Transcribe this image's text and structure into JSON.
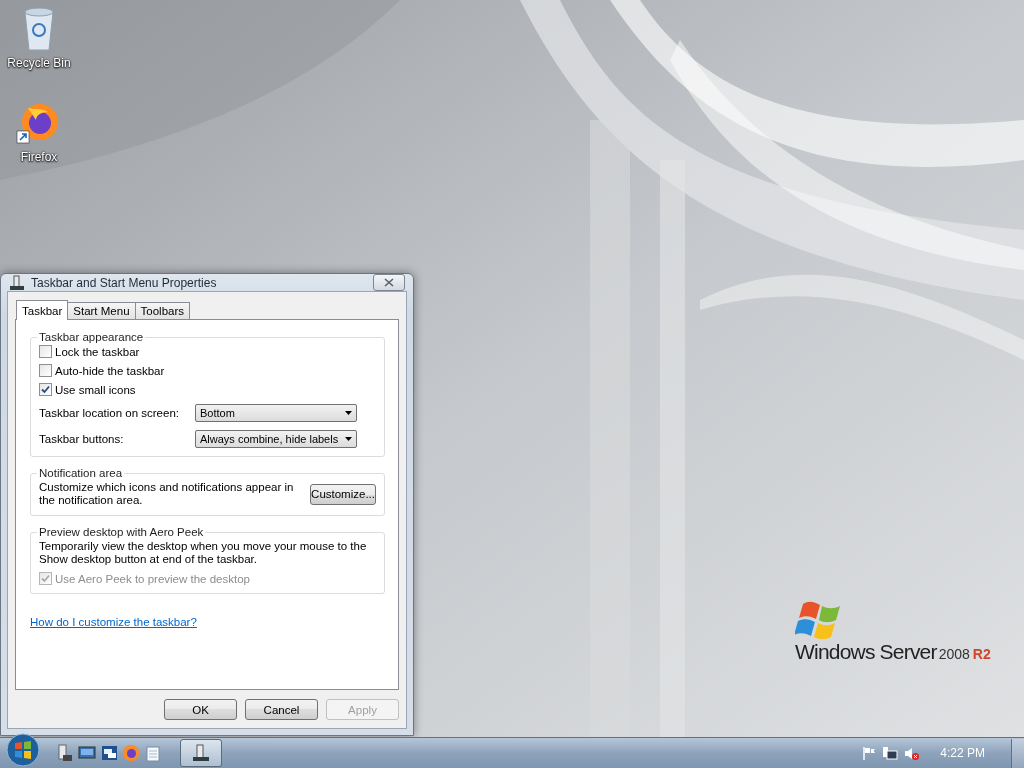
{
  "desktop_icons": [
    {
      "kind": "recycle-bin",
      "label": "Recycle Bin"
    },
    {
      "kind": "browser",
      "label": "Firefox"
    }
  ],
  "dialog": {
    "title": "Taskbar and Start Menu Properties",
    "tabs": [
      {
        "label": "Taskbar",
        "selected": true
      },
      {
        "label": "Start Menu",
        "selected": false
      },
      {
        "label": "Toolbars",
        "selected": false
      }
    ],
    "appearance": {
      "legend": "Taskbar appearance",
      "checkboxes": [
        {
          "label": "Lock the taskbar",
          "checked": false
        },
        {
          "label": "Auto-hide the taskbar",
          "checked": false
        },
        {
          "label": "Use small icons",
          "checked": true
        }
      ],
      "dropdowns": [
        {
          "label": "Taskbar location on screen:",
          "value": "Bottom"
        },
        {
          "label": "Taskbar buttons:",
          "value": "Always combine, hide labels"
        }
      ]
    },
    "notification": {
      "legend": "Notification area",
      "text": "Customize which icons and notifications appear in the notification area.",
      "button": "Customize..."
    },
    "peek": {
      "legend": "Preview desktop with Aero Peek",
      "text": "Temporarily view the desktop when you move your mouse to the Show desktop button at end of the taskbar.",
      "checkbox": {
        "label": "Use Aero Peek to preview the desktop",
        "checked": true,
        "disabled": true
      }
    },
    "help_link": "How do I customize the taskbar?",
    "buttons": [
      {
        "label": "OK",
        "disabled": false
      },
      {
        "label": "Cancel",
        "disabled": false
      },
      {
        "label": "Apply",
        "disabled": true
      }
    ]
  },
  "branding": {
    "name": "Windows Server",
    "version": "2008",
    "edition": "R2"
  },
  "taskbar": {
    "quick_launch": [
      {
        "kind": "server"
      },
      {
        "kind": "monitor"
      },
      {
        "kind": "windows"
      },
      {
        "kind": "browser"
      },
      {
        "kind": "notepad"
      }
    ],
    "windows": [
      {
        "kind": "properties",
        "selected": true
      }
    ],
    "tray": [
      {
        "kind": "flag"
      },
      {
        "kind": "network"
      },
      {
        "kind": "volume-muted"
      }
    ],
    "clock": "4:22 PM"
  }
}
